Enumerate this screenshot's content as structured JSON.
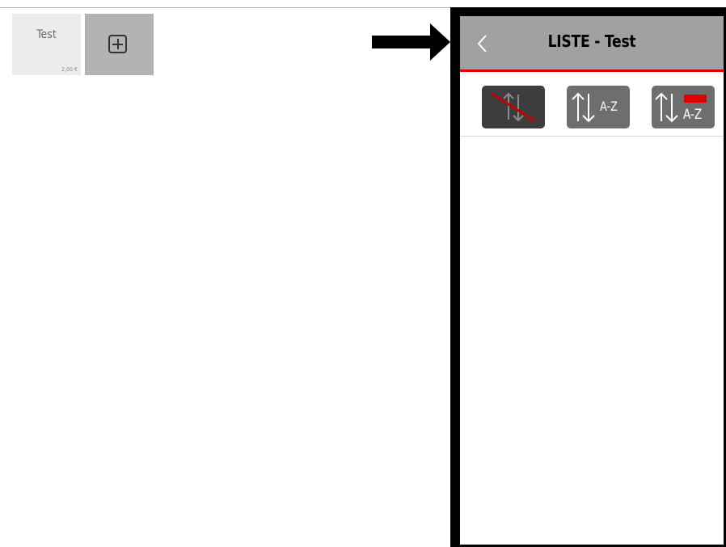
{
  "product_tile": {
    "name": "Test",
    "price": "2,00 €"
  },
  "add_tile": {
    "icon": "plus-square-icon"
  },
  "pointer": {
    "icon": "arrow-right-icon"
  },
  "phone": {
    "header": {
      "title": "LISTE - Test",
      "back_icon": "chevron-left-icon"
    },
    "sort_buttons": [
      {
        "id": "no-sort",
        "icon": "sort-disabled-icon",
        "label": ""
      },
      {
        "id": "sort-az",
        "icon": "sort-arrows-icon",
        "label": "A-Z"
      },
      {
        "id": "sort-az-highlight",
        "icon": "sort-arrows-icon",
        "label": "A-Z"
      }
    ],
    "colors": {
      "header_bg": "#a1a1a1",
      "accent_red": "#e00000",
      "button_dark": "#3d3d3d",
      "button_gray": "#6e6e6e"
    }
  }
}
